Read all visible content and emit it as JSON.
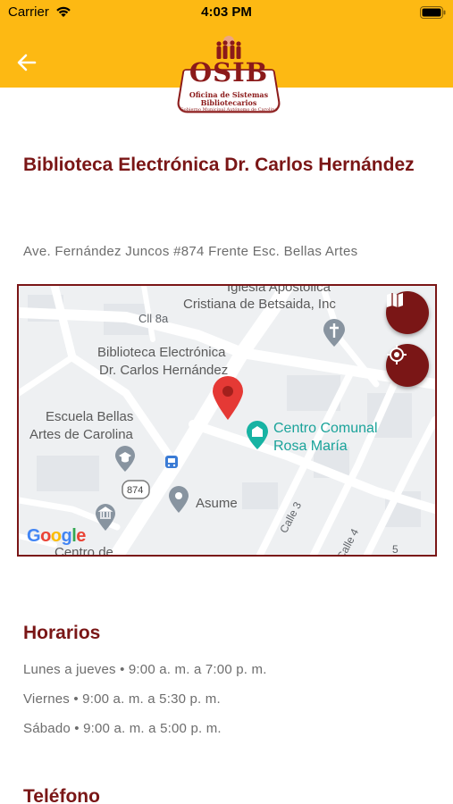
{
  "status_bar": {
    "carrier": "Carrier",
    "time": "4:03 PM"
  },
  "header": {
    "background_color": "#FDB913",
    "back_icon": "arrow-left-icon",
    "logo": {
      "title": "OSIB",
      "line1": "Oficina de Sistemas",
      "line2": "Bibliotecarios",
      "line3": "Gobierno Municipal Autónomo de Carolina"
    }
  },
  "library": {
    "name": "Biblioteca Electrónica Dr. Carlos Hernández",
    "address": "Ave. Fernández Juncos  #874 Frente Esc. Bellas Artes"
  },
  "map": {
    "labels": {
      "church_top": "Iglesia Apostólica",
      "church_name": "Cristiana de Betsaida, Inc",
      "street_cll8a": "Cll 8a",
      "library_line1": "Biblioteca Electrónica",
      "library_line2": "Dr. Carlos Hernández",
      "school_line1": "Escuela Bellas",
      "school_line2": "Artes de Carolina",
      "community_line1": "Centro Comunal",
      "community_line2": "Rosa María",
      "road_number": "874",
      "asume": "Asume",
      "calle3": "Calle 3",
      "calle4": "Calle 4",
      "calle5": "5",
      "centro": "Centro de",
      "google": "Google"
    },
    "buttons": {
      "map_icon": "map-icon",
      "locate_icon": "crosshair-icon"
    },
    "accent_color": "#7A1616"
  },
  "schedule": {
    "heading": "Horarios",
    "rows": [
      "Lunes a jueves • 9:00 a. m. a 7:00 p. m.",
      "Viernes • 9:00 a. m. a 5:30 p. m.",
      "Sábado • 9:00 a. m. a 5:00 p. m."
    ]
  },
  "phone": {
    "heading": "Teléfono"
  }
}
